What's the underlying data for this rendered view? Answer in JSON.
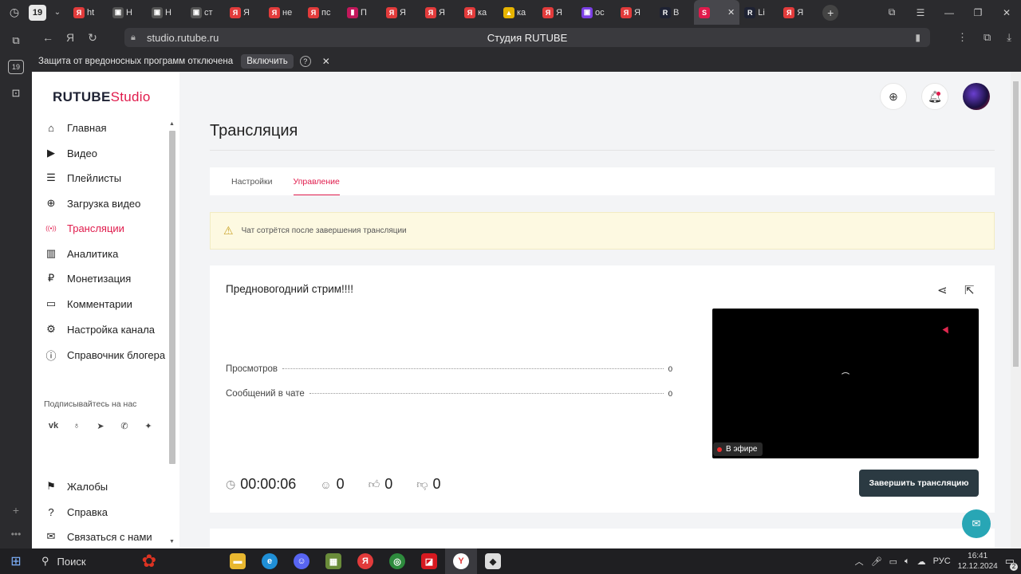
{
  "browser": {
    "tabs": [
      {
        "label": "ht",
        "fav": "Я",
        "color": "#e23b3b"
      },
      {
        "label": "Н",
        "fav": "▣",
        "color": "#555"
      },
      {
        "label": "Н",
        "fav": "▣",
        "color": "#555"
      },
      {
        "label": "ст",
        "fav": "▣",
        "color": "#555"
      },
      {
        "label": "Я",
        "fav": "Я",
        "color": "#e23b3b"
      },
      {
        "label": "не",
        "fav": "Я",
        "color": "#e23b3b"
      },
      {
        "label": "пс",
        "fav": "Я",
        "color": "#e23b3b"
      },
      {
        "label": "П",
        "fav": "▮",
        "color": "#c2185b"
      },
      {
        "label": "Я",
        "fav": "Я",
        "color": "#e23b3b"
      },
      {
        "label": "Я",
        "fav": "Я",
        "color": "#e23b3b"
      },
      {
        "label": "ка",
        "fav": "Я",
        "color": "#e23b3b"
      },
      {
        "label": "ка",
        "fav": "▲",
        "color": "#e7b400"
      },
      {
        "label": "Я",
        "fav": "Я",
        "color": "#e23b3b"
      },
      {
        "label": "ос",
        "fav": "▣",
        "color": "#7b3fe4"
      },
      {
        "label": "Я",
        "fav": "Я",
        "color": "#e23b3b"
      },
      {
        "label": "В",
        "fav": "R",
        "color": "#1e2233"
      },
      {
        "label": "",
        "fav": "S",
        "color": "#e01b4c"
      },
      {
        "label": "Li",
        "fav": "R",
        "color": "#1e2233"
      },
      {
        "label": "Я",
        "fav": "Я",
        "color": "#e23b3b"
      }
    ],
    "tab_count_badge": "19",
    "url": "studio.rutube.ru",
    "page_title": "Студия RUTUBE",
    "infobar_text": "Защита от вредоносных программ отключена",
    "infobar_button": "Включить",
    "infobar_help": "?",
    "close_glyph": "✕"
  },
  "logo": {
    "main": "RUTUBE",
    "suffix": "Studio"
  },
  "sidebar": {
    "items": [
      {
        "label": "Главная",
        "icon": "⌂"
      },
      {
        "label": "Видео",
        "icon": "▶"
      },
      {
        "label": "Плейлисты",
        "icon": "☰"
      },
      {
        "label": "Загрузка видео",
        "icon": "⊕"
      },
      {
        "label": "Трансляции",
        "icon": "((•))"
      },
      {
        "label": "Аналитика",
        "icon": "▥"
      },
      {
        "label": "Монетизация",
        "icon": "₽"
      },
      {
        "label": "Комментарии",
        "icon": "▭"
      },
      {
        "label": "Настройка канала",
        "icon": "⚙"
      },
      {
        "label": "Справочник блогера",
        "icon": "ⓘ"
      }
    ],
    "subscribe_label": "Подписывайтесь на нас",
    "socials": [
      "vk",
      "ok",
      "tg",
      "vb",
      "+"
    ],
    "bottom_items": [
      {
        "label": "Жалобы",
        "icon": "⚑"
      },
      {
        "label": "Справка",
        "icon": "?"
      },
      {
        "label": "Связаться с нами",
        "icon": "✉"
      }
    ]
  },
  "page": {
    "title": "Трансляция",
    "tabs": [
      "Настройки",
      "Управление"
    ],
    "warning": "Чат сотрётся после завершения трансляции",
    "stream_title": "Предновогодний стрим!!!!",
    "stats": [
      {
        "label": "Просмотров",
        "value": "0"
      },
      {
        "label": "Сообщений в чате",
        "value": "0"
      }
    ],
    "live_badge": "В эфире",
    "timer": "00:00:06",
    "viewers": "0",
    "likes": "0",
    "dislikes": "0",
    "end_button": "Завершить трансляцию"
  },
  "taskbar": {
    "search": "Поиск",
    "lang": "РУС",
    "time": "16:41",
    "date": "12.12.2024",
    "notif": "2"
  }
}
